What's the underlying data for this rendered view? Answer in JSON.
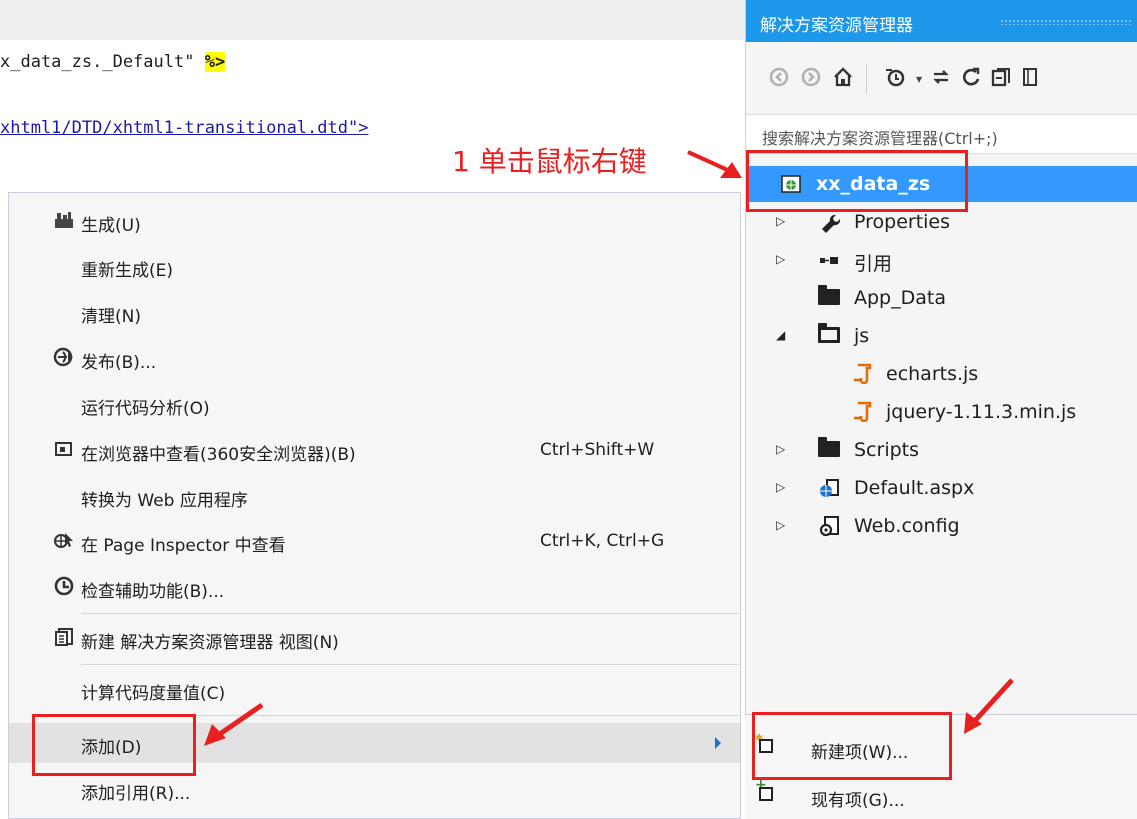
{
  "editor": {
    "line1_prefix": "x_data_zs._Default\" ",
    "line1_delim": "%>",
    "line2_link": "xhtml1/DTD/xhtml1-transitional.dtd\">"
  },
  "annotation": {
    "text": "1 单击鼠标右键",
    "color": "#e8201f"
  },
  "context_menu": {
    "items": [
      {
        "icon": "build-icon",
        "label": "生成(U)",
        "shortcut": ""
      },
      {
        "icon": "",
        "label": "重新生成(E)",
        "shortcut": ""
      },
      {
        "icon": "",
        "label": "清理(N)",
        "shortcut": ""
      },
      {
        "icon": "publish-icon",
        "label": "发布(B)...",
        "shortcut": ""
      },
      {
        "icon": "",
        "label": "运行代码分析(O)",
        "shortcut": ""
      },
      {
        "icon": "browser-icon",
        "label": "在浏览器中查看(360安全浏览器)(B)",
        "shortcut": "Ctrl+Shift+W"
      },
      {
        "icon": "",
        "label": "转换为 Web 应用程序",
        "shortcut": ""
      },
      {
        "icon": "page-inspector-icon",
        "label": "在 Page Inspector 中查看",
        "shortcut": "Ctrl+K, Ctrl+G"
      },
      {
        "icon": "accessibility-icon",
        "label": "检查辅助功能(B)...",
        "shortcut": ""
      },
      {
        "icon": "new-view-icon",
        "label": "新建 解决方案资源管理器 视图(N)",
        "shortcut": ""
      },
      {
        "icon": "",
        "label": "计算代码度量值(C)",
        "shortcut": ""
      },
      {
        "icon": "",
        "label": "添加(D)",
        "shortcut": ""
      },
      {
        "icon": "",
        "label": "添加引用(R)...",
        "shortcut": ""
      }
    ]
  },
  "solution_explorer": {
    "title": "解决方案资源管理器",
    "search_placeholder": "搜索解决方案资源管理器(Ctrl+;)",
    "accent_color": "#1c97ea",
    "selection_color": "#3399ff",
    "tree": [
      {
        "label": "xx_data_zs",
        "icon": "web-project-icon",
        "expander": ""
      },
      {
        "label": "Properties",
        "icon": "wrench-icon",
        "expander": "collapsed"
      },
      {
        "label": "引用",
        "icon": "references-icon",
        "expander": "collapsed"
      },
      {
        "label": "App_Data",
        "icon": "folder-icon",
        "expander": ""
      },
      {
        "label": "js",
        "icon": "folder-open-icon",
        "expander": "expanded"
      },
      {
        "label": "echarts.js",
        "icon": "js-file-icon",
        "expander": ""
      },
      {
        "label": "jquery-1.11.3.min.js",
        "icon": "js-file-icon",
        "expander": ""
      },
      {
        "label": "Scripts",
        "icon": "folder-icon",
        "expander": "collapsed"
      },
      {
        "label": "Default.aspx",
        "icon": "aspx-file-icon",
        "expander": "collapsed"
      },
      {
        "label": "Web.config",
        "icon": "config-file-icon",
        "expander": "collapsed"
      }
    ]
  },
  "submenu": {
    "items": [
      {
        "label": "新建项(W)...",
        "icon": "new-item-icon"
      },
      {
        "label": "现有项(G)...",
        "icon": "existing-item-icon"
      }
    ]
  }
}
